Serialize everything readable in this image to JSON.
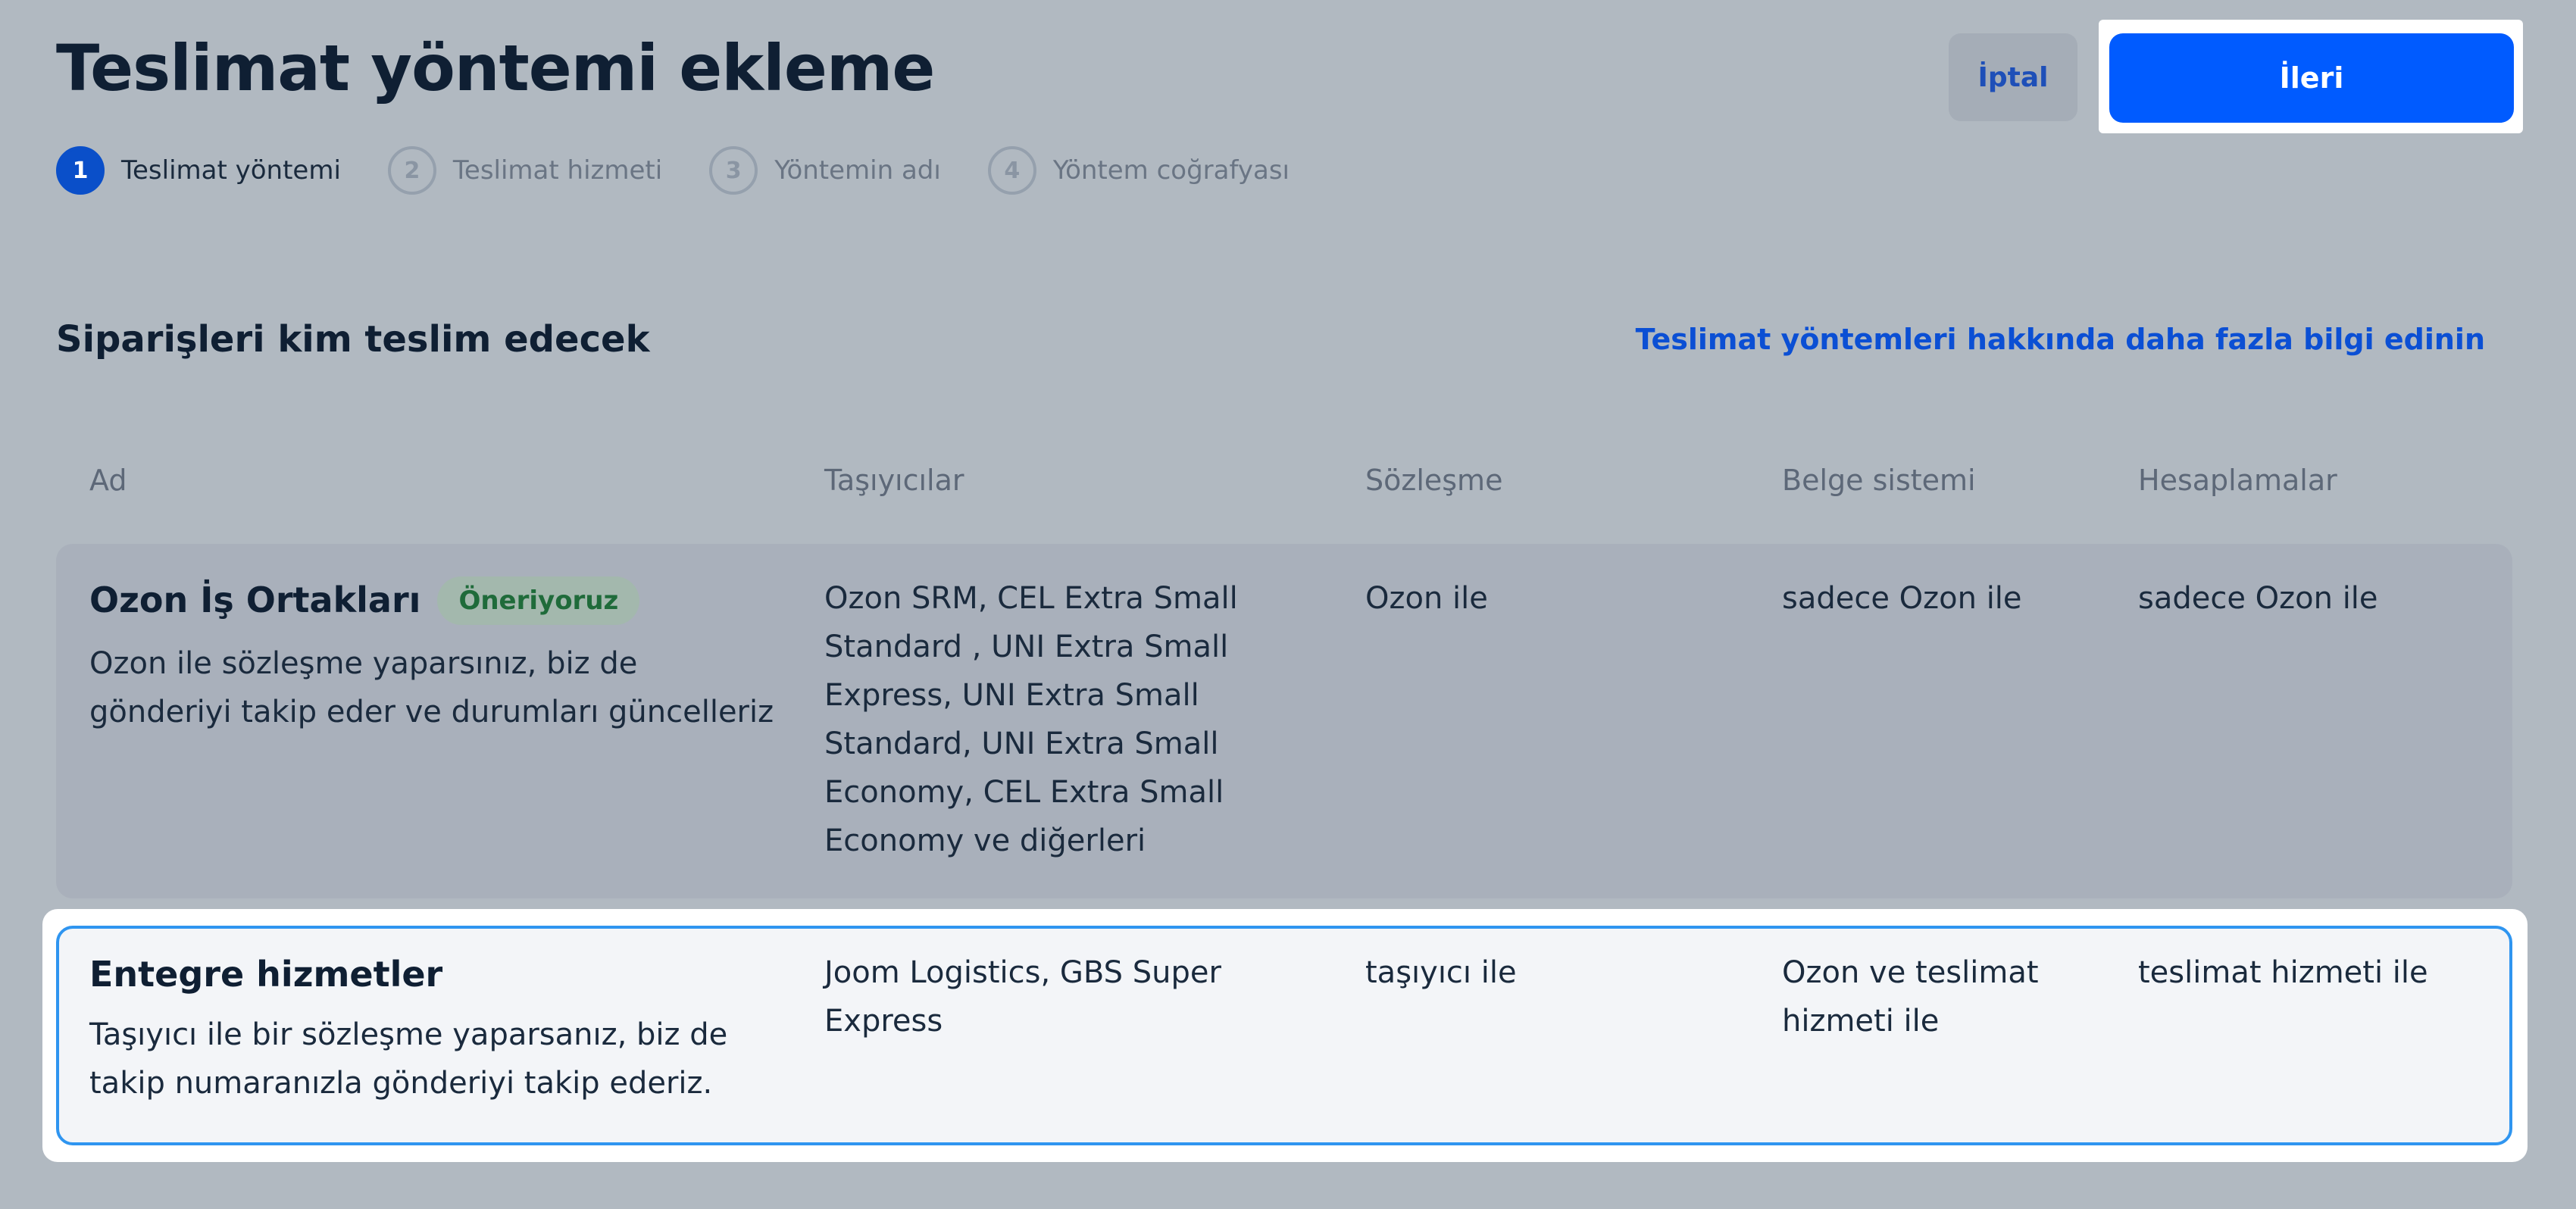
{
  "header": {
    "title": "Teslimat yöntemi ekleme",
    "cancel_label": "İptal",
    "next_label": "İleri"
  },
  "stepper": {
    "steps": [
      {
        "number": "1",
        "label": "Teslimat yöntemi"
      },
      {
        "number": "2",
        "label": "Teslimat hizmeti"
      },
      {
        "number": "3",
        "label": "Yöntemin adı"
      },
      {
        "number": "4",
        "label": "Yöntem coğrafyası"
      }
    ]
  },
  "section": {
    "title": "Siparişleri kim teslim edecek",
    "info_link": "Teslimat yöntemleri hakkında daha fazla bilgi edinin"
  },
  "table": {
    "columns": [
      "Ad",
      "Taşıyıcılar",
      "Sözleşme",
      "Belge sistemi",
      "Hesaplamalar"
    ],
    "rows": [
      {
        "name": "Ozon İş Ortakları",
        "badge": "Öneriyoruz",
        "description": "Ozon ile sözleşme yaparsınız, biz de gönderiyi takip eder ve durumları güncelleriz",
        "carriers": "Ozon SRM, CEL Extra Small Standard , UNI Extra Small Express, UNI Extra Small Standard, UNI Extra Small Economy, CEL Extra Small Economy ve diğerleri",
        "contract": "Ozon ile",
        "document_system": "sadece Ozon ile",
        "settlements": "sadece Ozon ile"
      },
      {
        "name": "Entegre hizmetler",
        "description": "Taşıyıcı ile bir sözleşme yaparsanız, biz de takip numaranızla gönderiyi takip ederiz.",
        "carriers": "Joom Logistics, GBS Super Express",
        "contract": "taşıyıcı ile",
        "document_system": "Ozon ve teslimat hizmeti ile",
        "settlements": "teslimat hizmeti ile"
      }
    ]
  },
  "colors": {
    "background": "#b1b9c1",
    "primary": "#005bff",
    "link": "#0b4fd4",
    "selected_border": "#2f95f0",
    "badge_bg": "#a3b8ad",
    "badge_text": "#1f6b3a"
  }
}
